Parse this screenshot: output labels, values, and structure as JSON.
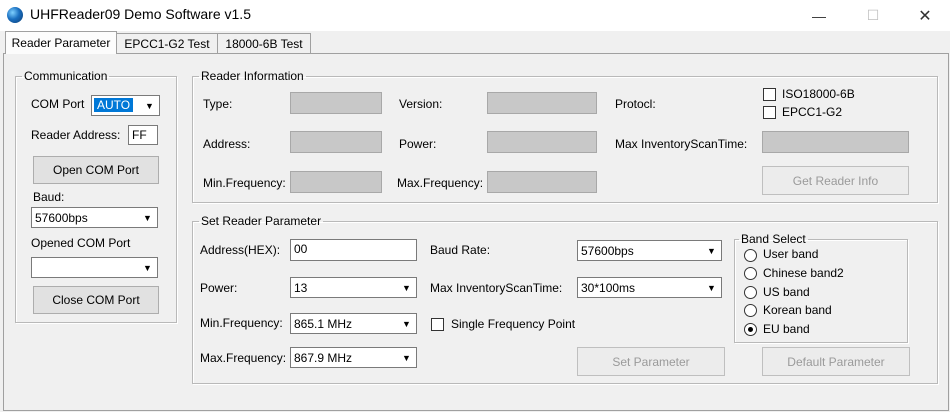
{
  "window": {
    "title": "UHFReader09 Demo Software v1.5",
    "minimize": "—",
    "maximize": "☐",
    "close": "✕"
  },
  "tabs": [
    {
      "label": "Reader Parameter"
    },
    {
      "label": "EPCC1-G2 Test"
    },
    {
      "label": "18000-6B Test"
    }
  ],
  "communication": {
    "legend": "Communication",
    "com_port_label": "COM Port",
    "com_port_value": "AUTO",
    "reader_address_label": "Reader Address:",
    "reader_address_value": "FF",
    "open_com_port": "Open COM Port",
    "baud_label": "Baud:",
    "baud_value": "57600bps",
    "opened_com_port_label": "Opened COM Port",
    "opened_com_port_value": "",
    "close_com_port": "Close COM Port"
  },
  "reader_info": {
    "legend": "Reader Information",
    "type_label": "Type:",
    "version_label": "Version:",
    "protocl_label": "Protocl:",
    "address_label": "Address:",
    "power_label": "Power:",
    "max_inventory_label": "Max InventoryScanTime:",
    "min_freq_label": "Min.Frequency:",
    "max_freq_label": "Max.Frequency:",
    "iso_label": "ISO18000-6B",
    "epc_label": "EPCC1-G2",
    "get_info_button": "Get Reader Info"
  },
  "set_param": {
    "legend": "Set Reader Parameter",
    "address_label": "Address(HEX):",
    "address_value": "00",
    "baud_rate_label": "Baud Rate:",
    "baud_rate_value": "57600bps",
    "power_label": "Power:",
    "power_value": "13",
    "max_inventory_label": "Max InventoryScanTime:",
    "max_inventory_value": "30*100ms",
    "min_freq_label": "Min.Frequency:",
    "min_freq_value": "865.1 MHz",
    "single_freq_label": "Single Frequency Point",
    "max_freq_label": "Max.Frequency:",
    "max_freq_value": "867.9 MHz",
    "set_button": "Set Parameter",
    "default_button": "Default Parameter"
  },
  "band_select": {
    "legend": "Band Select",
    "options": [
      {
        "label": "User band",
        "selected": false
      },
      {
        "label": "Chinese band2",
        "selected": false
      },
      {
        "label": "US band",
        "selected": false
      },
      {
        "label": "Korean band",
        "selected": false
      },
      {
        "label": "EU band",
        "selected": true
      }
    ]
  }
}
